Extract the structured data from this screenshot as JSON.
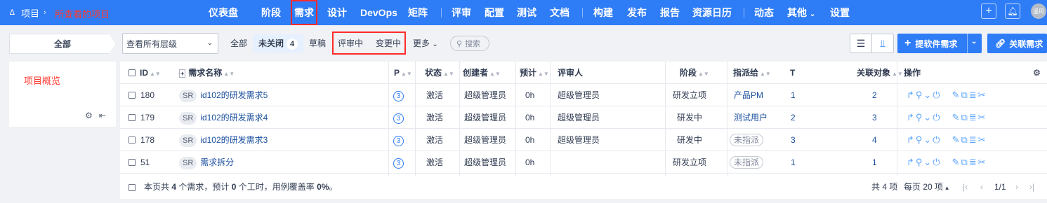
{
  "nav": {
    "brand": "项目",
    "project_name": "所查看的项目",
    "items": [
      "仪表盘",
      "阶段",
      "需求",
      "设计",
      "DevOps",
      "矩阵",
      "评审",
      "配置",
      "测试",
      "文档",
      "构建",
      "发布",
      "报告",
      "资源日历",
      "动态",
      "其他",
      "设置"
    ],
    "active": "需求",
    "avatar": "遥风"
  },
  "toolbar": {
    "all_label": "全部",
    "level_select": "查看所有层级",
    "tabs": {
      "all": "全部",
      "unclosed": "未关闭",
      "unclosed_count": "4",
      "draft": "草稿",
      "reviewing": "评审中",
      "changing": "变更中",
      "more": "更多"
    },
    "search_placeholder": "搜索",
    "create_button": "提软件需求",
    "link_button": "关联需求"
  },
  "left_panel": {
    "title": "项目概览"
  },
  "table": {
    "columns": {
      "id": "ID",
      "name": "需求名称",
      "pri": "P",
      "status": "状态",
      "creator": "创建者",
      "estimate": "预计",
      "reviewer": "评审人",
      "stage": "阶段",
      "assignee": "指派给",
      "t": "T",
      "linked": "关联对象",
      "actions": "操作"
    },
    "rows": [
      {
        "id": "180",
        "type": "SR",
        "name": "id102的研发需求5",
        "pri": "3",
        "status": "激活",
        "creator": "超级管理员",
        "estimate": "0h",
        "reviewer": "超级管理员",
        "stage": "研发立项",
        "assignee": "产品PM",
        "assigned": true,
        "t": "1",
        "linked": "2"
      },
      {
        "id": "179",
        "type": "SR",
        "name": "id102的研发需求4",
        "pri": "3",
        "status": "激活",
        "creator": "超级管理员",
        "estimate": "0h",
        "reviewer": "超级管理员",
        "stage": "研发中",
        "assignee": "测试用户",
        "assigned": true,
        "t": "2",
        "linked": "3"
      },
      {
        "id": "178",
        "type": "SR",
        "name": "id102的研发需求3",
        "pri": "3",
        "status": "激活",
        "creator": "超级管理员",
        "estimate": "0h",
        "reviewer": "超级管理员",
        "stage": "研发中",
        "assignee": "未指派",
        "assigned": false,
        "t": "3",
        "linked": "4"
      },
      {
        "id": "51",
        "type": "SR",
        "name": "需求拆分",
        "pri": "3",
        "status": "激活",
        "creator": "超级管理员",
        "estimate": "0h",
        "reviewer": "",
        "stage": "研发立项",
        "assignee": "未指派",
        "assigned": false,
        "t": "1",
        "linked": "1"
      }
    ]
  },
  "footer": {
    "summary_prefix": "本页共",
    "summary_count": "4",
    "summary_mid": "个需求，预计",
    "summary_hours": "0",
    "summary_mid2": "个工时，用例覆盖率",
    "summary_cov": "0%",
    "summary_end": "。",
    "total": "共 4 项",
    "per_page": "每页 20 项",
    "page": "1/1"
  }
}
